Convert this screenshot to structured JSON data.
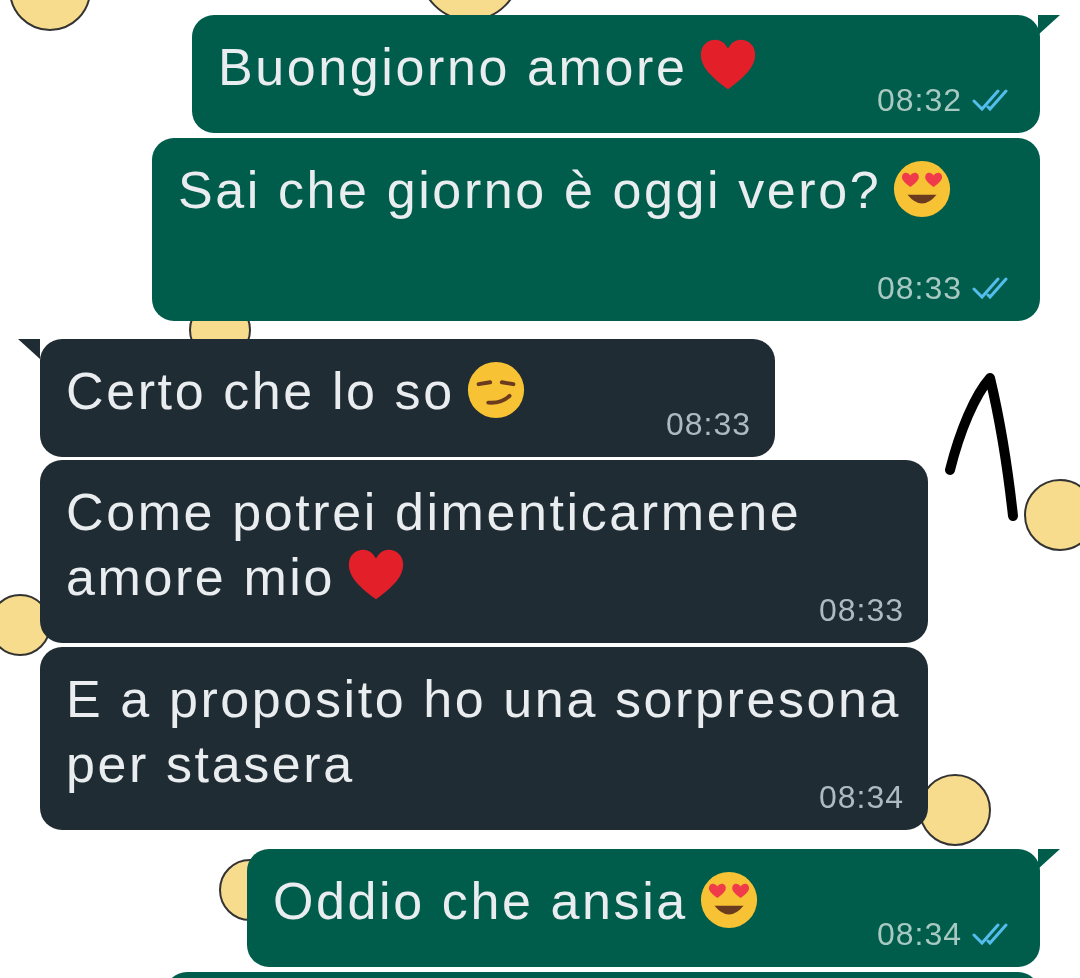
{
  "messages": [
    {
      "outgoing": true,
      "text": "Buongiorno amore",
      "emoji": {
        "kind": "heart"
      },
      "time": "08:32",
      "read": true
    },
    {
      "outgoing": true,
      "text": "Sai che giorno è oggi vero?",
      "emoji": {
        "kind": "heart-eyes"
      },
      "time": "08:33",
      "read": true
    },
    {
      "outgoing": false,
      "text": "Certo che lo so",
      "emoji": {
        "kind": "smirk"
      },
      "time": "08:33"
    },
    {
      "outgoing": false,
      "text": "Come potrei dimenticarmene amore mio",
      "emoji": {
        "kind": "heart"
      },
      "time": "08:33"
    },
    {
      "outgoing": false,
      "text": "E a proposito ho una sorpresona per stasera",
      "time": "08:34"
    },
    {
      "outgoing": true,
      "text": "Oddio che ansia",
      "emoji": {
        "kind": "heart-eyes"
      },
      "time": "08:34",
      "read": true
    },
    {
      "outgoing": true
    }
  ]
}
